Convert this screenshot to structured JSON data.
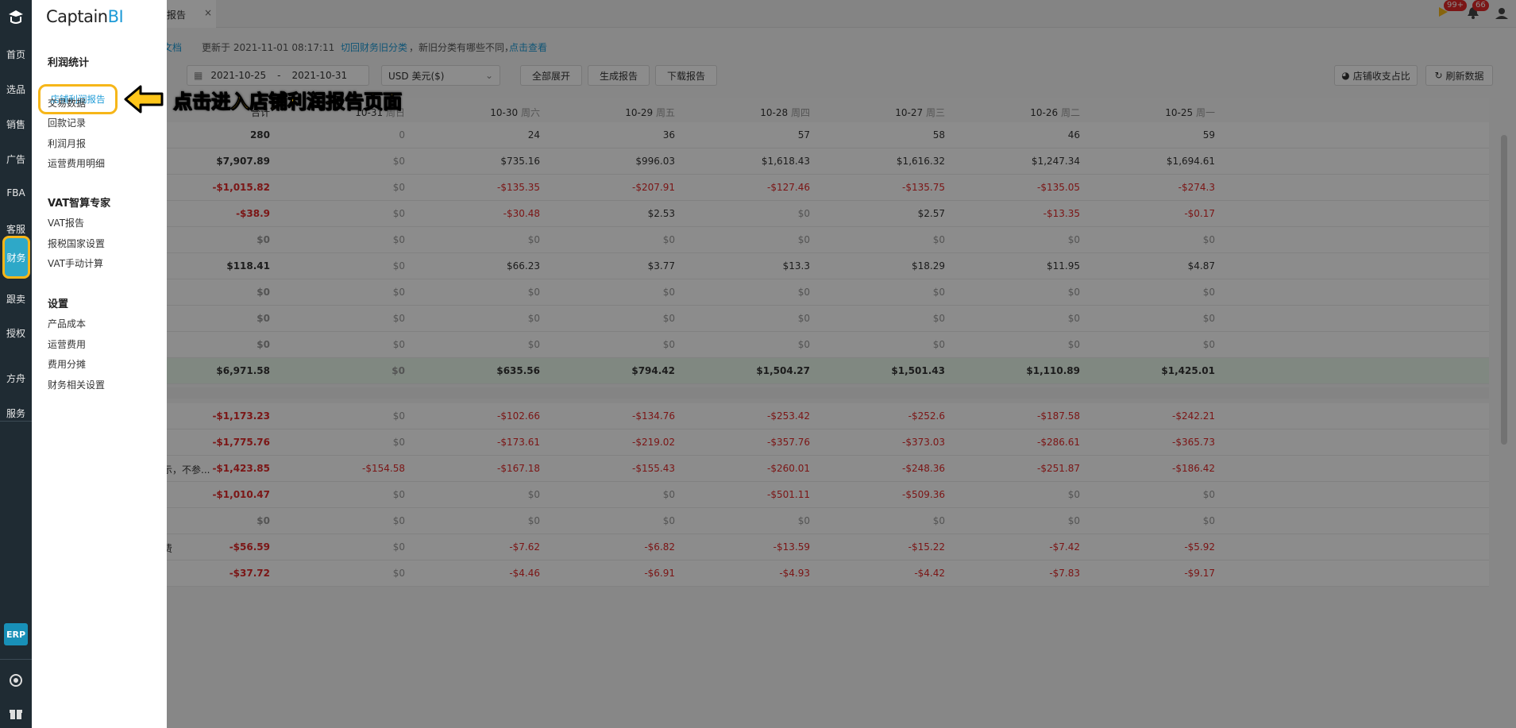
{
  "rail": {
    "items": [
      "首页",
      "选品",
      "销售",
      "广告",
      "FBA",
      "客服",
      "财务",
      "跟卖",
      "授权",
      "方舟",
      "服务"
    ],
    "active": "财务",
    "erp": "ERP"
  },
  "flyout": {
    "brand_main": "Captain",
    "brand_accent": "BI",
    "sections": [
      {
        "title": "利润统计",
        "links": [
          "店铺利润报告",
          "交易数据",
          "回款记录",
          "利润月报",
          "运营费用明细"
        ]
      },
      {
        "title": "VAT智算专家",
        "links": [
          "VAT报告",
          "报税国家设置",
          "VAT手动计算"
        ]
      },
      {
        "title": "设置",
        "links": [
          "产品成本",
          "运营费用",
          "费用分摊",
          "财务相关设置"
        ]
      }
    ]
  },
  "callout": {
    "text": "点击进入店铺利润报告页面"
  },
  "tabbar": {
    "tab_label": "报告",
    "badge1": "99+",
    "badge2": "66"
  },
  "infobar": {
    "doc": "文档",
    "updated": "更新于 2021-11-01 08:17:11",
    "switch_link": "切回财务旧分类",
    "note": "，新旧分类有哪些不同，",
    "view_link": "点击查看"
  },
  "toolbar": {
    "date_start": "2021-10-25",
    "date_sep": "-",
    "date_end": "2021-10-31",
    "currency": "USD  美元($)",
    "expand": "全部展开",
    "generate": "生成报告",
    "download": "下载报告",
    "ratio": "店铺收支占比",
    "refresh": "刷新数据"
  },
  "table": {
    "headers": [
      {
        "date": "合计",
        "weekday": ""
      },
      {
        "date": "10-31",
        "weekday": "周日"
      },
      {
        "date": "10-30",
        "weekday": "周六"
      },
      {
        "date": "10-29",
        "weekday": "周五"
      },
      {
        "date": "10-28",
        "weekday": "周四"
      },
      {
        "date": "10-27",
        "weekday": "周三"
      },
      {
        "date": "10-26",
        "weekday": "周二"
      },
      {
        "date": "10-25",
        "weekday": "周一"
      }
    ],
    "rows_a": [
      {
        "label": "",
        "values": [
          "280",
          "0",
          "24",
          "36",
          "57",
          "58",
          "46",
          "59"
        ]
      },
      {
        "label": "",
        "values": [
          "$7,907.89",
          "$0",
          "$735.16",
          "$996.03",
          "$1,618.43",
          "$1,616.32",
          "$1,247.34",
          "$1,694.61"
        ]
      },
      {
        "label": "",
        "values": [
          "-$1,015.82",
          "$0",
          "-$135.35",
          "-$207.91",
          "-$127.46",
          "-$135.75",
          "-$135.05",
          "-$274.3"
        ]
      },
      {
        "label": "",
        "values": [
          "-$38.9",
          "$0",
          "-$30.48",
          "$2.53",
          "$0",
          "$2.57",
          "-$13.35",
          "-$0.17"
        ]
      },
      {
        "label": "",
        "values": [
          "$0",
          "$0",
          "$0",
          "$0",
          "$0",
          "$0",
          "$0",
          "$0"
        ]
      },
      {
        "label": "",
        "values": [
          "$118.41",
          "$0",
          "$66.23",
          "$3.77",
          "$13.3",
          "$18.29",
          "$11.95",
          "$4.87"
        ]
      },
      {
        "label": "",
        "values": [
          "$0",
          "$0",
          "$0",
          "$0",
          "$0",
          "$0",
          "$0",
          "$0"
        ]
      },
      {
        "label": "",
        "values": [
          "$0",
          "$0",
          "$0",
          "$0",
          "$0",
          "$0",
          "$0",
          "$0"
        ]
      },
      {
        "label": "",
        "values": [
          "$0",
          "$0",
          "$0",
          "$0",
          "$0",
          "$0",
          "$0",
          "$0"
        ]
      },
      {
        "label": "",
        "values": [
          "$6,971.58",
          "$0",
          "$635.56",
          "$794.42",
          "$1,504.27",
          "$1,501.43",
          "$1,110.89",
          "$1,425.01"
        ],
        "total": true
      }
    ],
    "rows_b": [
      {
        "label": "",
        "values": [
          "-$1,173.23",
          "$0",
          "-$102.66",
          "-$134.76",
          "-$253.42",
          "-$252.6",
          "-$187.58",
          "-$242.21"
        ]
      },
      {
        "label": "",
        "values": [
          "-$1,775.76",
          "$0",
          "-$173.61",
          "-$219.02",
          "-$357.76",
          "-$373.03",
          "-$286.61",
          "-$365.73"
        ]
      },
      {
        "label": "示，不参...",
        "values": [
          "-$1,423.85",
          "-$154.58",
          "-$167.18",
          "-$155.43",
          "-$260.01",
          "-$248.36",
          "-$251.87",
          "-$186.42"
        ]
      },
      {
        "label": "",
        "values": [
          "-$1,010.47",
          "$0",
          "$0",
          "$0",
          "-$501.11",
          "-$509.36",
          "$0",
          "$0"
        ]
      },
      {
        "label": "",
        "values": [
          "$0",
          "$0",
          "$0",
          "$0",
          "$0",
          "$0",
          "$0",
          "$0"
        ]
      },
      {
        "label": "费",
        "values": [
          "-$56.59",
          "$0",
          "-$7.62",
          "-$6.82",
          "-$13.59",
          "-$15.22",
          "-$7.42",
          "-$5.92"
        ]
      },
      {
        "label": "",
        "values": [
          "-$37.72",
          "$0",
          "-$4.46",
          "-$6.91",
          "-$4.93",
          "-$4.42",
          "-$7.83",
          "-$9.17"
        ]
      }
    ]
  },
  "colors": {
    "accent": "#1e9bd7",
    "highlight": "#f6b619",
    "rail": "#1f2b33",
    "negative": "#e02828"
  }
}
